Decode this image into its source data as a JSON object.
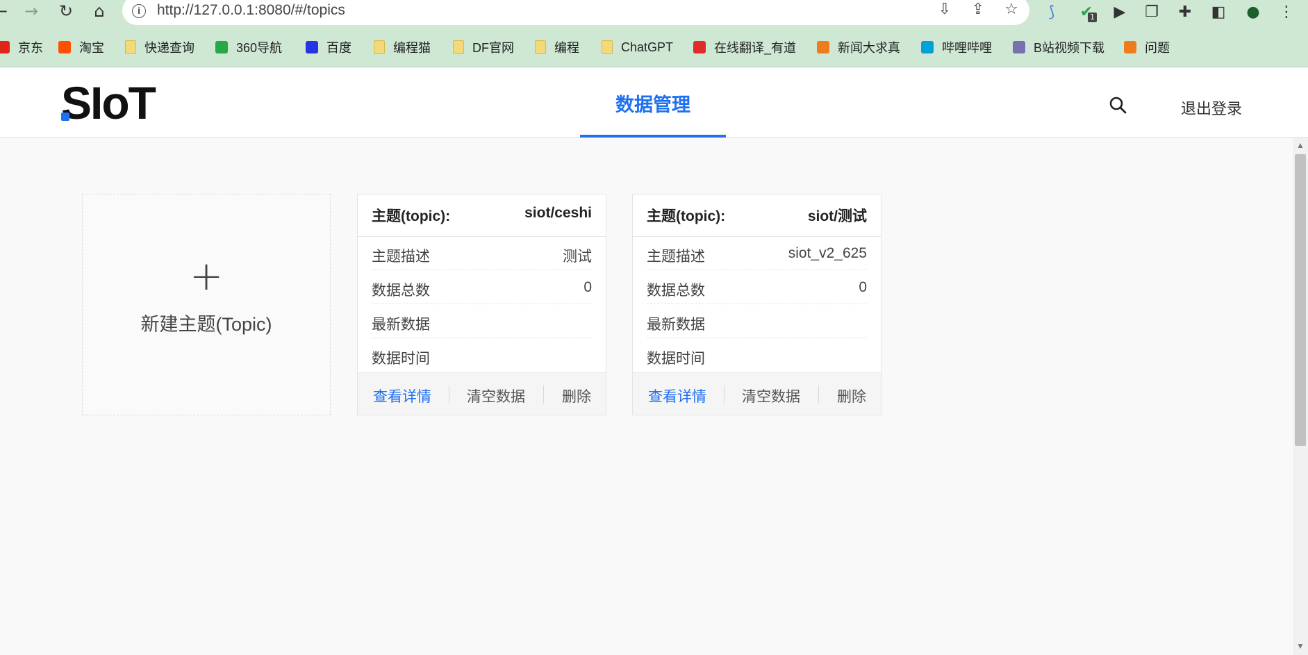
{
  "browser": {
    "url": "http://127.0.0.1:8080/#/topics",
    "ext_badge": "1",
    "bookmarks": [
      {
        "label": "京东",
        "color": "#e1251b"
      },
      {
        "label": "淘宝",
        "color": "#ff5000"
      },
      {
        "label": "快递查询",
        "color": "#f3d97a"
      },
      {
        "label": "360导航",
        "color": "#27a745"
      },
      {
        "label": "百度",
        "color": "#2932e1"
      },
      {
        "label": "编程猫",
        "color": "#f3d97a"
      },
      {
        "label": "DF官网",
        "color": "#f3d97a"
      },
      {
        "label": "编程",
        "color": "#f3d97a"
      },
      {
        "label": "ChatGPT",
        "color": "#f3d97a"
      },
      {
        "label": "在线翻译_有道",
        "color": "#e02b2b"
      },
      {
        "label": "新闻大求真",
        "color": "#f07b1c"
      },
      {
        "label": "哔哩哔哩",
        "color": "#00a1d6"
      },
      {
        "label": "B站视频下载",
        "color": "#7a6fb2"
      },
      {
        "label": "问题",
        "color": "#f07b1c"
      }
    ]
  },
  "header": {
    "logo": "SIoT",
    "nav_active": "数据管理",
    "logout": "退出登录"
  },
  "new_topic": {
    "plus": "+",
    "label": "新建主题(Topic)"
  },
  "topics": [
    {
      "head_label": "主题(topic):",
      "head_value": "siot/ceshi",
      "rows": [
        {
          "label": "主题描述",
          "value": "测试"
        },
        {
          "label": "数据总数",
          "value": "0"
        },
        {
          "label": "最新数据",
          "value": ""
        },
        {
          "label": "数据时间",
          "value": ""
        }
      ],
      "actions": [
        "查看详情",
        "清空数据",
        "删除"
      ]
    },
    {
      "head_label": "主题(topic):",
      "head_value": "siot/测试",
      "rows": [
        {
          "label": "主题描述",
          "value": "siot_v2_625"
        },
        {
          "label": "数据总数",
          "value": "0"
        },
        {
          "label": "最新数据",
          "value": ""
        },
        {
          "label": "数据时间",
          "value": ""
        }
      ],
      "actions": [
        "查看详情",
        "清空数据",
        "删除"
      ]
    }
  ],
  "colors": {
    "accent": "#1e6ff1",
    "chrome": "#cfe8d4",
    "background": "#f9f9f9"
  }
}
